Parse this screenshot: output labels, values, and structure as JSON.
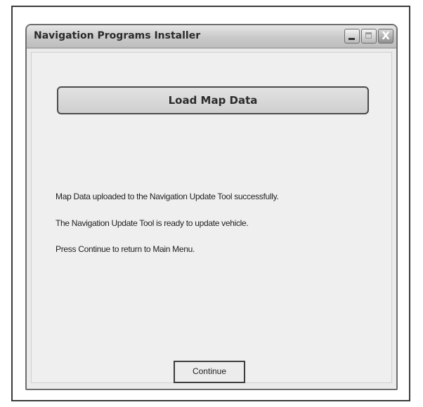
{
  "window": {
    "title": "Navigation Programs Installer",
    "controls": {
      "minimize_icon": "minimize-icon",
      "maximize_icon": "maximize-icon",
      "close_icon": "close-icon",
      "close_glyph": "X"
    }
  },
  "banner": {
    "label": "Load Map Data"
  },
  "messages": [
    "Map Data uploaded to the Navigation Update Tool successfully.",
    "The Navigation Update Tool is ready to update vehicle.",
    "Press Continue to return to Main Menu."
  ],
  "buttons": {
    "continue_label": "Continue"
  }
}
